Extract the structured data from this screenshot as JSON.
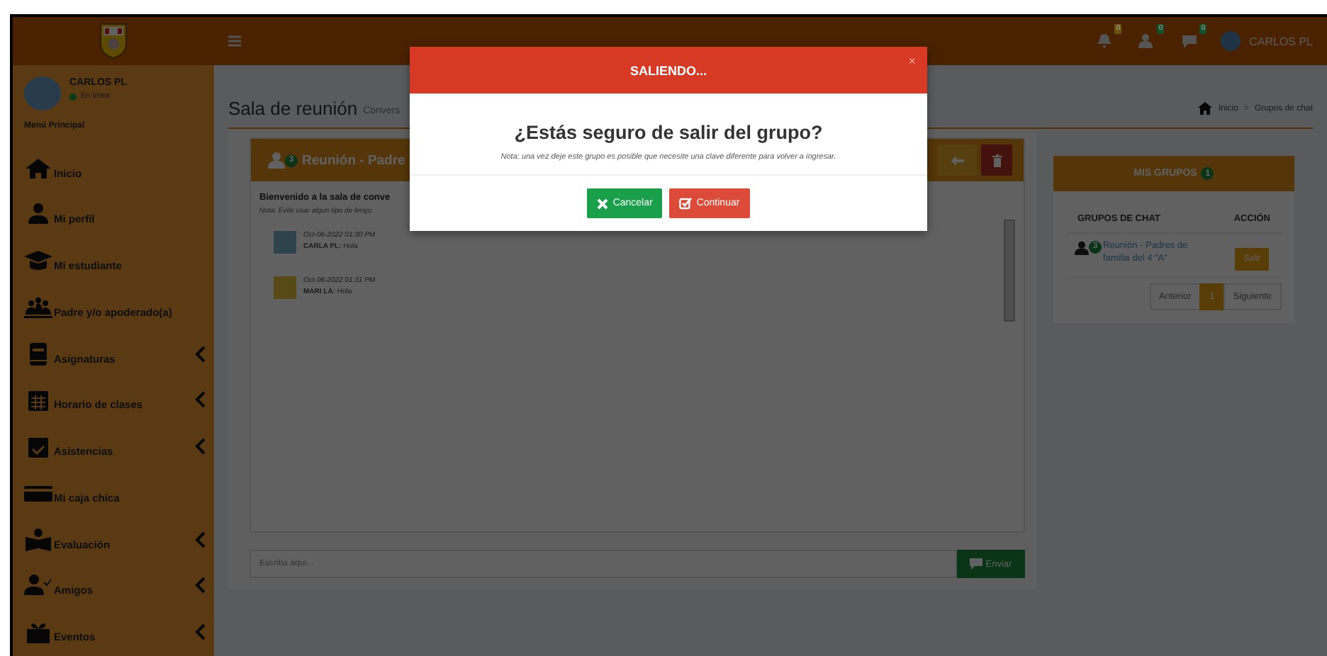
{
  "header": {
    "notifications": [
      {
        "count": "0",
        "color": "#6a5410"
      },
      {
        "count": "0",
        "color": "#14502a"
      },
      {
        "count": "0",
        "color": "#14502a"
      }
    ],
    "user": "CARLOS PL"
  },
  "sidebar": {
    "user": "CARLOS PL",
    "status": "En línea",
    "section": "Menú Principal",
    "items": [
      {
        "label": "Inicio",
        "has_submenu": false
      },
      {
        "label": "Mi perfil",
        "has_submenu": false
      },
      {
        "label": "Mi estudiante",
        "has_submenu": false
      },
      {
        "label": "Padre y/o apoderado(a)",
        "has_submenu": false
      },
      {
        "label": "Asignaturas",
        "has_submenu": true
      },
      {
        "label": "Horario de clases",
        "has_submenu": true
      },
      {
        "label": "Asistencias",
        "has_submenu": true
      },
      {
        "label": "Mi caja chica",
        "has_submenu": false
      },
      {
        "label": "Evaluación",
        "has_submenu": true
      },
      {
        "label": "Amigos",
        "has_submenu": true
      },
      {
        "label": "Eventos",
        "has_submenu": true
      }
    ]
  },
  "page": {
    "title": "Sala de reunión",
    "subtitle": "Convers",
    "breadcrumb": [
      "Inicio",
      "Grupos de chat"
    ],
    "breadcrumb_separator": ">"
  },
  "chat": {
    "member_count": "3",
    "title": "Reunión - Padre",
    "welcome": "Bienvenido a la sala de conve",
    "note": "Nota: Evite usar algun tipo de lengu",
    "messages": [
      {
        "time": "Oct-06-2022 01:30 PM",
        "author": "CARLA PL:",
        "text": "Hola"
      },
      {
        "time": "Oct-06-2022 01:31 PM",
        "author": "MARI LA:",
        "text": "Hola"
      }
    ],
    "input": {
      "placeholder": "Escriba aquí..."
    },
    "send": "Enviar"
  },
  "groups": {
    "title": "MIS GRUPOS",
    "count": "1",
    "columns": [
      "GRUPOS DE CHAT",
      "ACCIÓN"
    ],
    "rows": [
      {
        "member_count": "3",
        "name": "Reunión - Padres de familia del 4 \"A\"",
        "action": "Salir"
      }
    ],
    "pagination": {
      "previous": "Anterior",
      "pages": [
        {
          "label": "1",
          "selected": true
        }
      ],
      "next": "Siguiente"
    }
  },
  "modal": {
    "title": "SALIENDO...",
    "close": "×",
    "question": "¿Estás seguro de salir del grupo?",
    "note": "Nota: una vez deje este grupo es posible que necesite una clave diferente para volver a ingresar.",
    "buttons": [
      {
        "label": "Cancelar",
        "kind": "cancel"
      },
      {
        "label": "Continuar",
        "kind": "confirm"
      }
    ]
  }
}
